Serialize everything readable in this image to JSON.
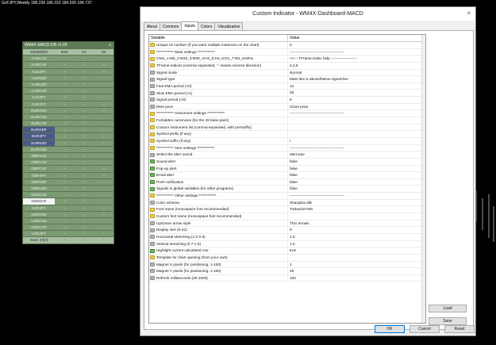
{
  "chart": {
    "title": "GcFJPY,Weekly  185.236 186.223 184.526 184.737"
  },
  "dashboard": {
    "title": "WM4X-MACD-DB v1.05",
    "close_label": "x",
    "headers": [
      "12/26/9@0",
      "M15",
      "H1",
      "H4"
    ],
    "rows": [
      {
        "sym": "AUDCAD",
        "style": ""
      },
      {
        "sym": "AUDCHF",
        "style": ""
      },
      {
        "sym": "AUDJPY",
        "style": ""
      },
      {
        "sym": "AUDNZD",
        "style": ""
      },
      {
        "sym": "AUDUSD",
        "style": ""
      },
      {
        "sym": "CADCHF",
        "style": ""
      },
      {
        "sym": "CADJPY",
        "style": ""
      },
      {
        "sym": "CHFJPY",
        "style": ""
      },
      {
        "sym": "EURAUD",
        "style": ""
      },
      {
        "sym": "EURCAD",
        "style": ""
      },
      {
        "sym": "EURCHF",
        "style": ""
      },
      {
        "sym": "EURGBP",
        "style": "blue"
      },
      {
        "sym": "EURJPY",
        "style": "blue"
      },
      {
        "sym": "EURNZD",
        "style": "blue"
      },
      {
        "sym": "EURUSD",
        "style": ""
      },
      {
        "sym": "GBPAUD",
        "style": ""
      },
      {
        "sym": "GBPCAD",
        "style": ""
      },
      {
        "sym": "GBPCHF",
        "style": ""
      },
      {
        "sym": "GBPJPY",
        "style": ""
      },
      {
        "sym": "GBPNZD",
        "style": ""
      },
      {
        "sym": "GBPUSD",
        "style": ""
      },
      {
        "sym": "NZDCAD",
        "style": ""
      },
      {
        "sym": "NZDCHF",
        "style": "white"
      },
      {
        "sym": "NZDJPY",
        "style": ""
      },
      {
        "sym": "NZDUSD",
        "style": ""
      },
      {
        "sym": "USDCAD",
        "style": ""
      },
      {
        "sym": "USDCHF",
        "style": ""
      },
      {
        "sym": "USDJPY",
        "style": ""
      }
    ],
    "cell_glyph": "~",
    "sum_label": "Sum: 3 [H]",
    "sum_cells": [
      "-",
      "-",
      "-"
    ]
  },
  "dialog": {
    "title": "Custom Indicator - WM4X-Dashboard-MACD",
    "close": "×",
    "tabs": [
      "About",
      "Common",
      "Inputs",
      "Colors",
      "Visualization"
    ],
    "active_tab": 2,
    "col_variable": "Variable",
    "col_value": "Value",
    "rows": [
      {
        "icon": "ab",
        "k": "Unique ID number (if you want multiple instances on the chart)",
        "v": "0"
      },
      {
        "icon": "ab",
        "k": "************  Main settings  ************",
        "v": "--------------------------------------------"
      },
      {
        "icon": "ab",
        "k": "0:M1_1:M5_2:M15_3:M30_4:H1_5:H4_6:D1_7:W1_8:MN1",
        "v": "<<---  TFrame-index help  ---------------------"
      },
      {
        "icon": "ab",
        "k": "TFrame-indices (comma-separated, '-' means reverse direction)",
        "v": "2,4,5"
      },
      {
        "icon": "val",
        "k": "Signal mode",
        "v": "Normal"
      },
      {
        "icon": "val",
        "k": "Signal type",
        "v": "Main-line is above/below signal-line"
      },
      {
        "icon": "val",
        "k": "Fast EMA period (>0)",
        "v": "12"
      },
      {
        "icon": "val",
        "k": "Slow EMA period (>1)",
        "v": "26"
      },
      {
        "icon": "val",
        "k": "Signal period (>0)",
        "v": "9"
      },
      {
        "icon": "val",
        "k": "EMA price",
        "v": "Close price"
      },
      {
        "icon": "ab",
        "k": "************  Instrument settings  ************",
        "v": "--------------------------------------------"
      },
      {
        "icon": "ab",
        "k": "Forbidden currencies (for the 28 base pairs)",
        "v": ""
      },
      {
        "icon": "ab",
        "k": "Custom instrument list (comma-separated, with pre/suffix)",
        "v": ""
      },
      {
        "icon": "ab",
        "k": "Symbol prefix (if any)",
        "v": ""
      },
      {
        "icon": "ab",
        "k": "Symbol suffix (if any)",
        "v": "i"
      },
      {
        "icon": "ab",
        "k": "************  Alert settings  ************",
        "v": "--------------------------------------------"
      },
      {
        "icon": "val",
        "k": "Select the alert sound",
        "v": "alert.wav"
      },
      {
        "icon": "bool",
        "k": "Sound alert",
        "v": "false"
      },
      {
        "icon": "bool",
        "k": "Pop-up alert",
        "v": "false"
      },
      {
        "icon": "bool",
        "k": "Email alert",
        "v": "false"
      },
      {
        "icon": "bool",
        "k": "Push notification",
        "v": "false"
      },
      {
        "icon": "bool",
        "k": "Signals in global variables (for other programs)",
        "v": "false"
      },
      {
        "icon": "ab",
        "k": "************  Other settings  ************",
        "v": "--------------------------------------------"
      },
      {
        "icon": "val",
        "k": "Color schema",
        "v": "Shanghai silk"
      },
      {
        "icon": "ab",
        "k": "Font name (monospace font recommended)",
        "v": "Trebuchet MS"
      },
      {
        "icon": "ab",
        "k": "Custom font name (monospace font recommended)",
        "v": ""
      },
      {
        "icon": "val",
        "k": "Up/Down arrow style",
        "v": "Thin arrows"
      },
      {
        "icon": "val",
        "k": "Display size (5-42)",
        "v": "9"
      },
      {
        "icon": "val",
        "k": "Horizontal stretching (1.0-2.0)",
        "v": "1.0"
      },
      {
        "icon": "val",
        "k": "Vertical stretching (0.7-1.5)",
        "v": "1.0"
      },
      {
        "icon": "bool",
        "k": "Highlight current calculated row",
        "v": "true"
      },
      {
        "icon": "ab",
        "k": "Template for chart opening (from your own)",
        "v": ""
      },
      {
        "icon": "val",
        "k": "Magnet X pixels (for positioning, 1-100)",
        "v": "1"
      },
      {
        "icon": "val",
        "k": "Magnet Y pixels (for positioning, 1-100)",
        "v": "25"
      },
      {
        "icon": "val",
        "k": "Refresh milliseconds (25-1000)",
        "v": "100"
      }
    ],
    "load_label": "Load",
    "save_label": "Save",
    "ok_label": "OK",
    "cancel_label": "Cancel",
    "reset_label": "Reset"
  }
}
